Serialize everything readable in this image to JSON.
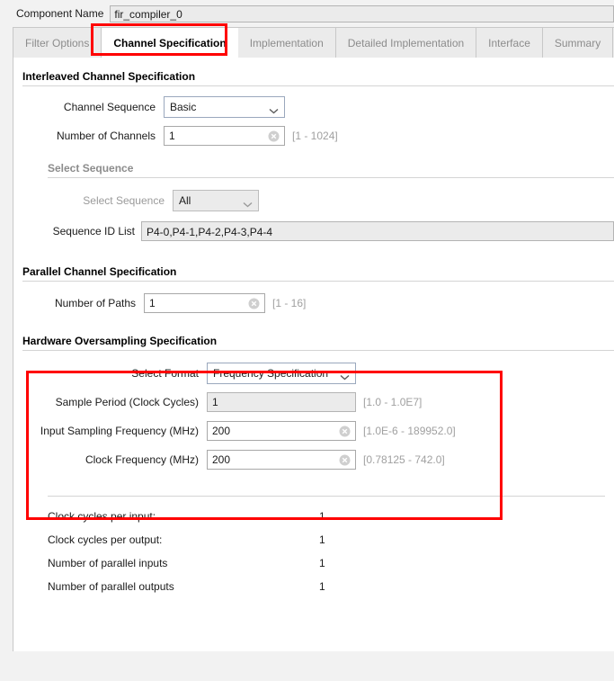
{
  "component": {
    "label": "Component Name",
    "value": "fir_compiler_0"
  },
  "tabs": [
    {
      "label": "Filter Options",
      "active": false
    },
    {
      "label": "Channel Specification",
      "active": true
    },
    {
      "label": "Implementation",
      "active": false
    },
    {
      "label": "Detailed Implementation",
      "active": false
    },
    {
      "label": "Interface",
      "active": false
    },
    {
      "label": "Summary",
      "active": false
    }
  ],
  "sections": {
    "interleaved": {
      "title": "Interleaved Channel Specification",
      "channel_sequence": {
        "label": "Channel Sequence",
        "value": "Basic"
      },
      "number_of_channels": {
        "label": "Number of Channels",
        "value": "1",
        "hint": "[1 - 1024]"
      }
    },
    "select_sequence_group": {
      "title": "Select Sequence",
      "select_sequence": {
        "label": "Select Sequence",
        "value": "All"
      },
      "sequence_id_list": {
        "label": "Sequence ID List",
        "value": "P4-0,P4-1,P4-2,P4-3,P4-4"
      }
    },
    "parallel": {
      "title": "Parallel Channel Specification",
      "number_of_paths": {
        "label": "Number of Paths",
        "value": "1",
        "hint": "[1 - 16]"
      }
    },
    "oversampling": {
      "title": "Hardware Oversampling Specification",
      "select_format": {
        "label": "Select Format",
        "value": "Frequency Specification"
      },
      "sample_period": {
        "label": "Sample Period (Clock Cycles)",
        "value": "1",
        "hint": "[1.0 - 1.0E7]"
      },
      "input_sampling_frequency": {
        "label": "Input Sampling Frequency (MHz)",
        "value": "200",
        "hint": "[1.0E-6 - 189952.0]"
      },
      "clock_frequency": {
        "label": "Clock Frequency (MHz)",
        "value": "200",
        "hint": "[0.78125 - 742.0]"
      }
    }
  },
  "summary": [
    {
      "label": "Clock cycles per input:",
      "value": "1"
    },
    {
      "label": "Clock cycles per output:",
      "value": "1"
    },
    {
      "label": "Number of parallel inputs",
      "value": "1"
    },
    {
      "label": "Number of parallel outputs",
      "value": "1"
    }
  ],
  "colors": {
    "annotation": "#ff0000",
    "panel_bg": "#ffffff",
    "window_bg": "#f2f2f2"
  }
}
